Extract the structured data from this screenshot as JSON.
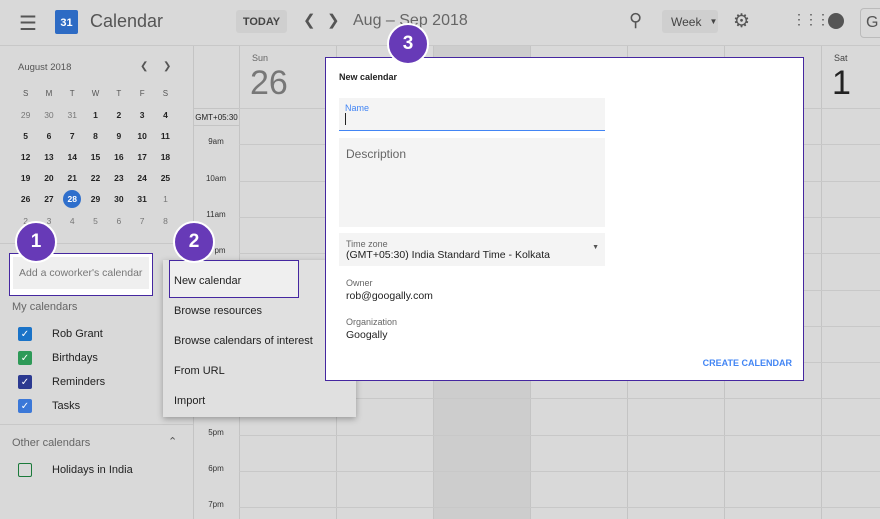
{
  "header": {
    "app_title": "Calendar",
    "logo_day": "31",
    "today_label": "TODAY",
    "date_range": "Aug – Sep 2018",
    "view_label": "Week",
    "account_initial": "G"
  },
  "mini_calendar": {
    "month_label": "August 2018",
    "weekdays": [
      "S",
      "M",
      "T",
      "W",
      "T",
      "F",
      "S"
    ],
    "weeks": [
      [
        "29",
        "30",
        "31",
        "1",
        "2",
        "3",
        "4"
      ],
      [
        "5",
        "6",
        "7",
        "8",
        "9",
        "10",
        "11"
      ],
      [
        "12",
        "13",
        "14",
        "15",
        "16",
        "17",
        "18"
      ],
      [
        "19",
        "20",
        "21",
        "22",
        "23",
        "24",
        "25"
      ],
      [
        "26",
        "27",
        "28",
        "29",
        "30",
        "31",
        "1"
      ],
      [
        "2",
        "3",
        "4",
        "5",
        "6",
        "7",
        "8"
      ]
    ],
    "selected": "28"
  },
  "sidebar": {
    "add_coworker_placeholder": "Add a coworker's calendar",
    "my_calendars_title": "My calendars",
    "my_calendars": [
      {
        "label": "Rob Grant",
        "color": "#1a73c8",
        "checked": true
      },
      {
        "label": "Birthdays",
        "color": "#2e9a58",
        "checked": true
      },
      {
        "label": "Reminders",
        "color": "#2b3990",
        "checked": true
      },
      {
        "label": "Tasks",
        "color": "#3b78d8",
        "checked": true
      }
    ],
    "other_calendars_title": "Other calendars",
    "other_calendars": [
      {
        "label": "Holidays in India",
        "color": "#1b7a3a",
        "checked": false
      }
    ]
  },
  "grid": {
    "timezone": "GMT+05:30",
    "times": [
      "9am",
      "10am",
      "11am",
      "pm",
      "5pm",
      "6pm",
      "7pm"
    ],
    "days": [
      {
        "name": "Sun",
        "date": "26"
      },
      {
        "name": "Sat",
        "date": "1"
      }
    ]
  },
  "menu": {
    "items": [
      "New calendar",
      "Browse resources",
      "Browse calendars of interest",
      "From URL",
      "Import"
    ]
  },
  "dialog": {
    "title": "New calendar",
    "name_label": "Name",
    "name_value": "",
    "description_placeholder": "Description",
    "timezone_label": "Time zone",
    "timezone_value": "(GMT+05:30) India Standard Time - Kolkata",
    "owner_label": "Owner",
    "owner_value": "rob@googally.com",
    "org_label": "Organization",
    "org_value": "Googally",
    "create_label": "CREATE CALENDAR"
  },
  "badges": [
    "1",
    "2",
    "3"
  ],
  "colors": {
    "accent": "#673ab7",
    "link": "#4285f4",
    "selected_day": "#2f6fcc"
  }
}
